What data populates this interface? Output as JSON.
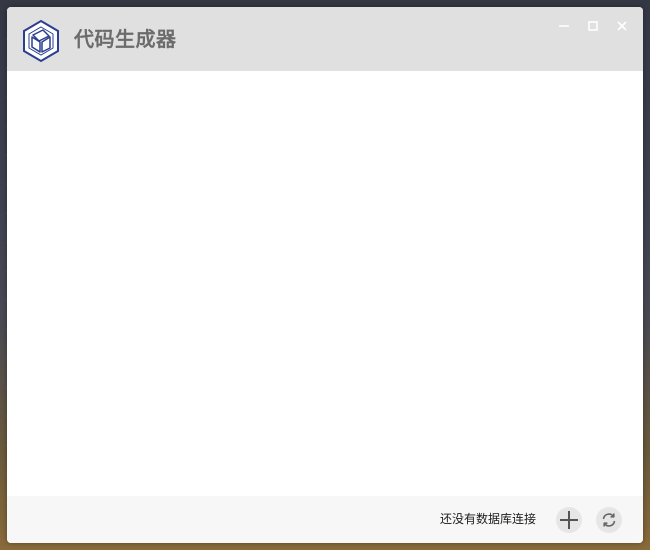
{
  "window": {
    "title": "代码生成器",
    "logo_icon": "hexagon-logo-icon"
  },
  "title_controls": {
    "minimize_icon": "minimize-icon",
    "maximize_icon": "maximize-icon",
    "close_icon": "close-icon"
  },
  "footer": {
    "status_text": "还没有数据库连接",
    "add_icon": "plus-icon",
    "refresh_icon": "refresh-icon"
  },
  "colors": {
    "titlebar": "#e0e0e0",
    "title_text": "#6b6b6b",
    "logo_blue": "#2c3e8f",
    "footer_bg": "#f7f7f7",
    "button_bg": "#e6e6e6"
  }
}
